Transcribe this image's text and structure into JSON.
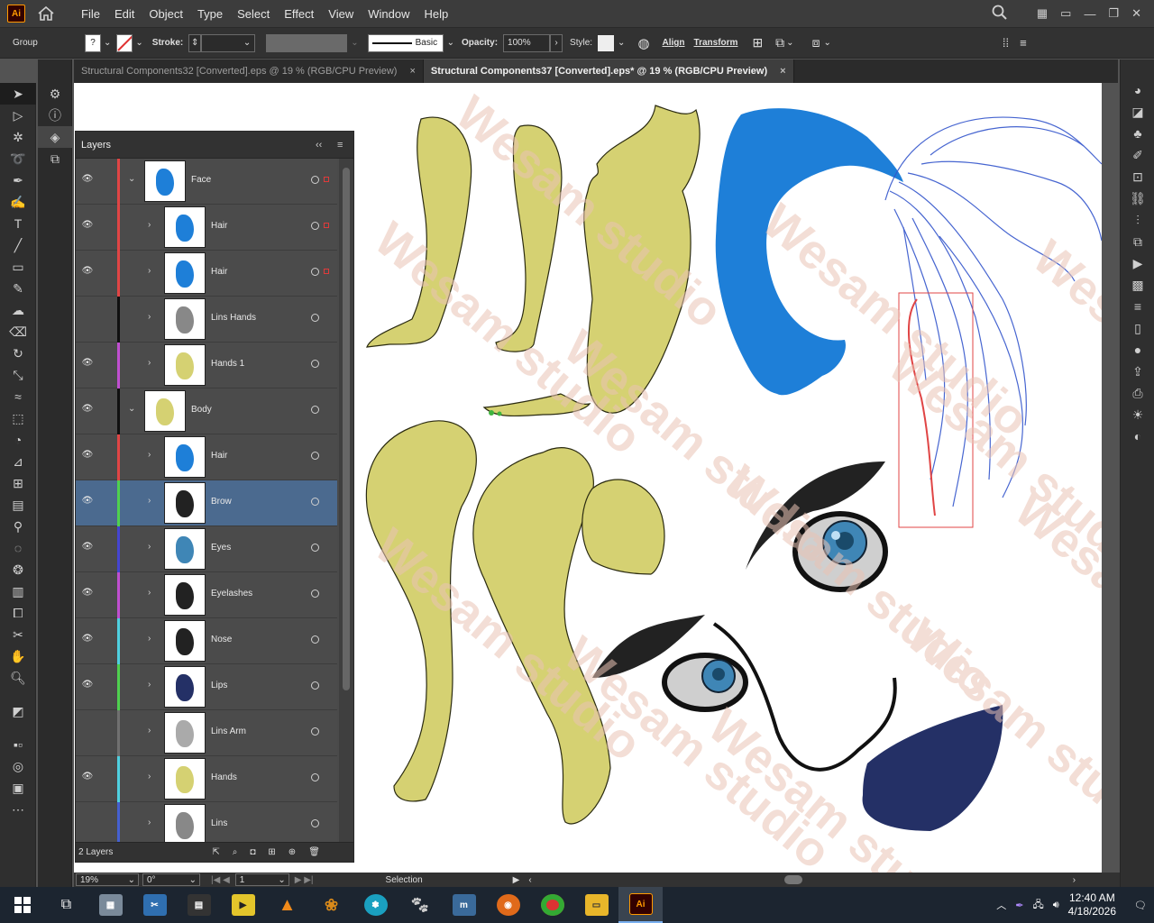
{
  "app": {
    "logo": "Ai",
    "menus": [
      "File",
      "Edit",
      "Object",
      "Type",
      "Select",
      "Effect",
      "View",
      "Window",
      "Help"
    ]
  },
  "control": {
    "selection_kind": "Group",
    "stroke_label": "Stroke:",
    "brush_label": "Basic",
    "opacity_label": "Opacity:",
    "opacity_value": "100%",
    "style_label": "Style:",
    "align_label": "Align",
    "transform_label": "Transform"
  },
  "tabs": [
    {
      "label": "Structural Components32 [Converted].eps @ 19 % (RGB/CPU Preview)",
      "close": "×"
    },
    {
      "label": "Structural Components37 [Converted].eps* @ 19 % (RGB/CPU Preview)",
      "close": "×"
    }
  ],
  "layers_panel": {
    "title": "Layers",
    "footer_count": "2 Layers",
    "rows": [
      {
        "name": "Face",
        "color": "#e04545",
        "visible": true,
        "level": 0,
        "expanded": true
      },
      {
        "name": "Hair",
        "color": "#e04545",
        "visible": true,
        "level": 1
      },
      {
        "name": "Hair",
        "color": "#e04545",
        "visible": true,
        "level": 1
      },
      {
        "name": "Lins Hands",
        "color": "#111111",
        "visible": false,
        "level": 1
      },
      {
        "name": "Hands 1",
        "color": "#c04fd0",
        "visible": true,
        "level": 1
      },
      {
        "name": "Body",
        "color": "#111111",
        "visible": true,
        "level": 0,
        "expanded": true
      },
      {
        "name": "Hair",
        "color": "#e04545",
        "visible": true,
        "level": 1
      },
      {
        "name": "Brow",
        "color": "#4fd04f",
        "visible": true,
        "level": 1,
        "selected": true
      },
      {
        "name": "Eyes",
        "color": "#4545d0",
        "visible": true,
        "level": 1
      },
      {
        "name": "Eyelashes",
        "color": "#c04fd0",
        "visible": true,
        "level": 1
      },
      {
        "name": "Nose",
        "color": "#4fd0e0",
        "visible": true,
        "level": 1
      },
      {
        "name": "Lips",
        "color": "#4fd04f",
        "visible": true,
        "level": 1
      },
      {
        "name": "Lins Arm",
        "color": "#707070",
        "visible": false,
        "level": 1
      },
      {
        "name": "Hands",
        "color": "#4fd0e0",
        "visible": true,
        "level": 1
      },
      {
        "name": "Lins",
        "color": "#4560d0",
        "visible": false,
        "level": 1
      }
    ]
  },
  "status": {
    "zoom": "19%",
    "rotation": "0°",
    "artboard": "1",
    "tool": "Selection"
  },
  "watermark": "Wesam studio",
  "taskbar": {
    "time": "12:40 AM",
    "date": "4/18/2026",
    "apps": [
      "Task View",
      "Files",
      "Snipping",
      "Studio",
      "Player",
      "VLC",
      "Paint",
      "Movie",
      "Gimp",
      "Store",
      "Firefox",
      "Chrome",
      "Explorer",
      "Ai"
    ]
  },
  "colors": {
    "accent_selected": "#4b6a8f",
    "skin": "#d5d172",
    "hair_blue": "#1e7fd8",
    "lips": "#243066"
  }
}
